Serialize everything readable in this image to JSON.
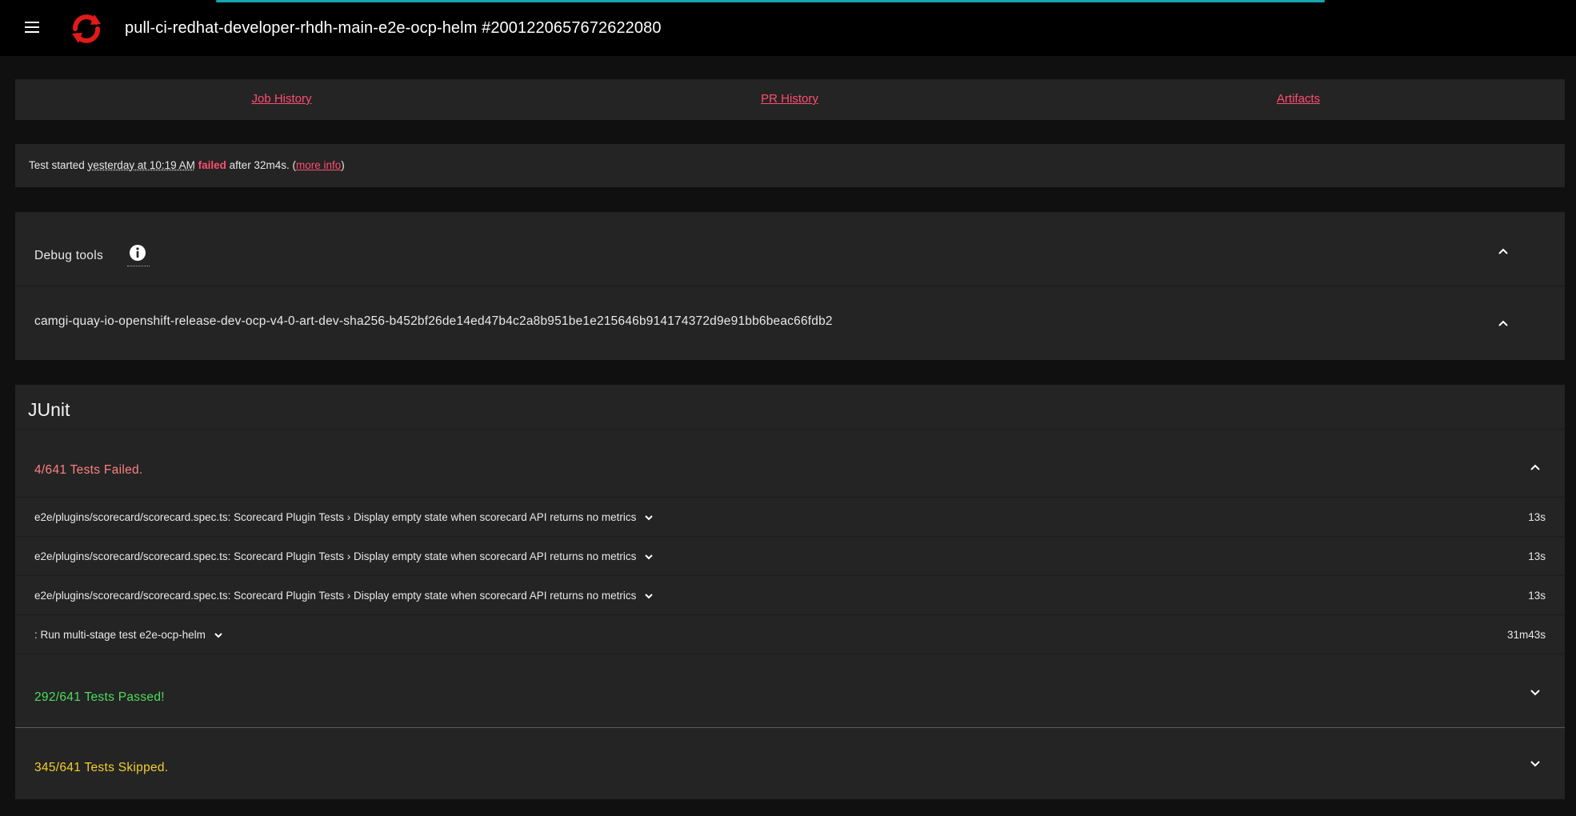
{
  "header": {
    "title": "pull-ci-redhat-developer-rhdh-main-e2e-ocp-helm #2001220657672622080",
    "menu_icon": "hamburger-menu-icon",
    "logo_icon": "prow-refresh-logo-icon"
  },
  "nav": {
    "job_history": "Job History",
    "pr_history": "PR History",
    "artifacts": "Artifacts"
  },
  "status": {
    "prefix": "Test started",
    "started": "yesterday at 10:19 AM",
    "result": "failed",
    "after": "after 32m4s. (",
    "more_info": "more info",
    "suffix": ")"
  },
  "debug": {
    "label": "Debug tools",
    "image": "camgi-quay-io-openshift-release-dev-ocp-v4-0-art-dev-sha256-b452bf26de14ed47b4c2a8b951be1e215646b914174372d9e91bb6beac66fdb2"
  },
  "junit": {
    "title": "JUnit",
    "failed_summary": "4/641 Tests Failed.",
    "failed_tests": [
      {
        "name": "e2e/plugins/scorecard/scorecard.spec.ts: Scorecard Plugin Tests › Display empty state when scorecard API returns no metrics",
        "duration": "13s"
      },
      {
        "name": "e2e/plugins/scorecard/scorecard.spec.ts: Scorecard Plugin Tests › Display empty state when scorecard API returns no metrics",
        "duration": "13s"
      },
      {
        "name": "e2e/plugins/scorecard/scorecard.spec.ts: Scorecard Plugin Tests › Display empty state when scorecard API returns no metrics",
        "duration": "13s"
      },
      {
        "name": ": Run multi-stage test e2e-ocp-helm",
        "duration": "31m43s"
      }
    ],
    "passed_summary": "292/641 Tests Passed!",
    "skipped_summary": "345/641 Tests Skipped."
  },
  "colors": {
    "accent": "#ff4d73",
    "fail": "#ff8080",
    "pass": "#4cdc5c",
    "skip": "#f2cf2f",
    "progress": "#19a5b3"
  }
}
